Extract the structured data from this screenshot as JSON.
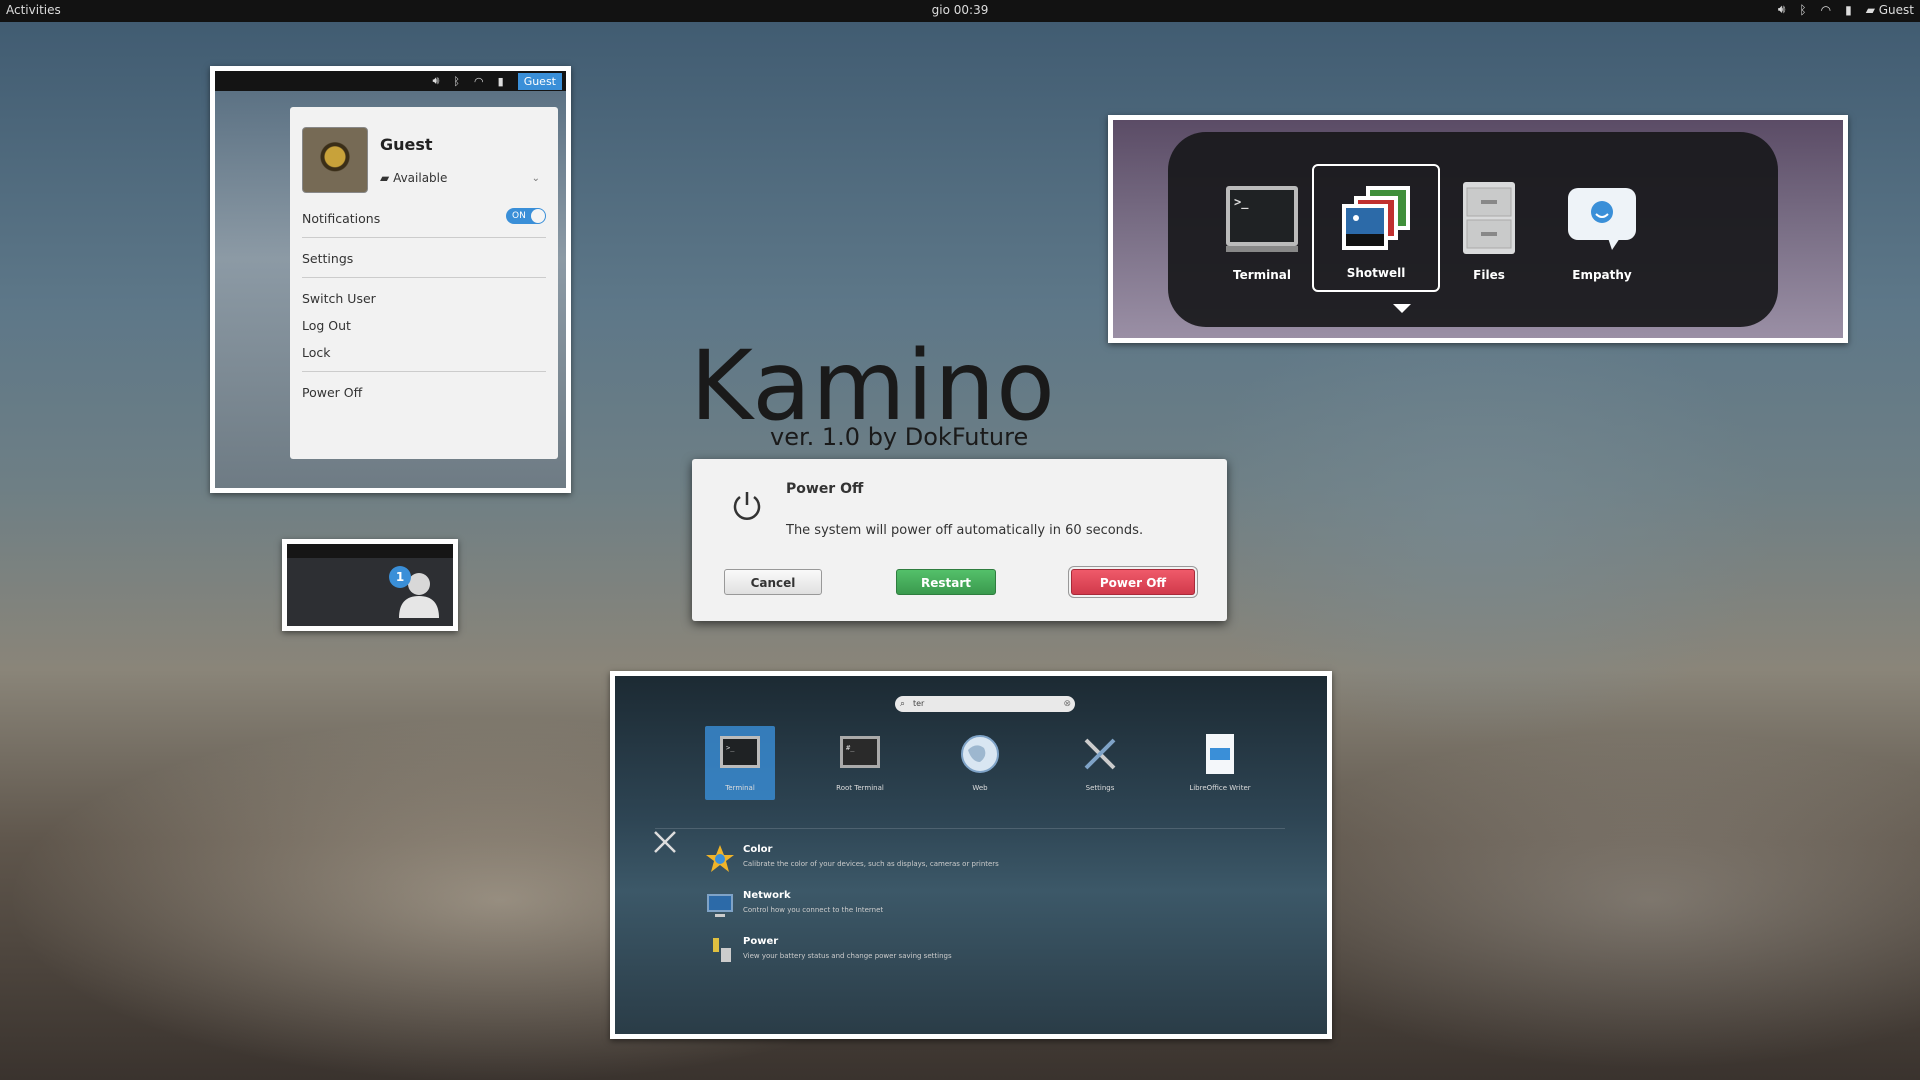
{
  "topbar": {
    "activities": "Activities",
    "clock": "gio 00:39",
    "user": "Guest",
    "icons": [
      "volume-icon",
      "bluetooth-icon",
      "wifi-icon",
      "battery-icon",
      "chat-icon"
    ]
  },
  "user_menu": {
    "bar_user": "Guest",
    "name": "Guest",
    "status": "Available",
    "notifications_label": "Notifications",
    "notifications_toggle": "ON",
    "items": {
      "settings": "Settings",
      "switch_user": "Switch User",
      "log_out": "Log Out",
      "lock": "Lock",
      "power_off": "Power Off"
    },
    "accent": "#3a8fd8"
  },
  "switcher": {
    "apps": [
      {
        "label": "Terminal",
        "icon": "terminal-icon"
      },
      {
        "label": "Shotwell",
        "icon": "photos-icon"
      },
      {
        "label": "Files",
        "icon": "file-cabinet-icon"
      },
      {
        "label": "Empathy",
        "icon": "chat-bubble-icon"
      }
    ],
    "selected": "Shotwell"
  },
  "branding": {
    "title": "Kamino",
    "subtitle": "ver. 1.0  by DokFuture"
  },
  "dialog": {
    "title": "Power Off",
    "message": "The system will power off automatically in 60 seconds.",
    "buttons": {
      "cancel": "Cancel",
      "restart": "Restart",
      "power_off": "Power Off"
    },
    "colors": {
      "restart": "#4aaf5d",
      "power_off": "#e04a5b"
    }
  },
  "notification": {
    "badge": "1"
  },
  "overview": {
    "search_value": "ter",
    "apps": [
      {
        "label": "Terminal"
      },
      {
        "label": "Root Terminal"
      },
      {
        "label": "Web"
      },
      {
        "label": "Settings"
      },
      {
        "label": "LibreOffice Writer"
      }
    ],
    "settings": [
      {
        "name": "Color",
        "desc": "Calibrate the color of your devices, such as displays, cameras or printers"
      },
      {
        "name": "Network",
        "desc": "Control how you connect to the Internet"
      },
      {
        "name": "Power",
        "desc": "View your battery status and change power saving settings"
      }
    ]
  }
}
